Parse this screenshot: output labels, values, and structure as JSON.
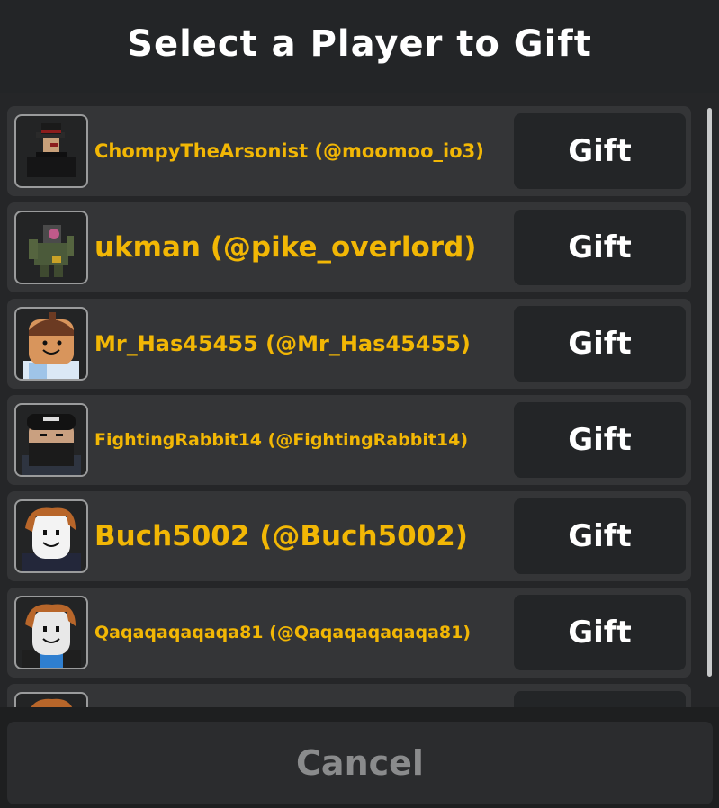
{
  "dialog": {
    "title": "Select a Player to Gift",
    "cancel_label": "Cancel"
  },
  "players": [
    {
      "name": "ChompyTheArsonist (@moomoo_io3)",
      "button": "Gift",
      "avatar": "avatar-fedora-icon"
    },
    {
      "name": "ukman (@pike_overlord)",
      "button": "Gift",
      "avatar": "avatar-camo-icon"
    },
    {
      "name": "Mr_Has45455 (@Mr_Has45455)",
      "button": "Gift",
      "avatar": "avatar-smile-icon"
    },
    {
      "name": "FightingRabbit14 (@FightingRabbit14)",
      "button": "Gift",
      "avatar": "avatar-masked-icon"
    },
    {
      "name": "Buch5002 (@Buch5002)",
      "button": "Gift",
      "avatar": "avatar-noob-icon"
    },
    {
      "name": "Qaqaqaqaqaqa81 (@Qaqaqaqaqaqa81)",
      "button": "Gift",
      "avatar": "avatar-noob-blue-icon"
    },
    {
      "name": "",
      "button": "",
      "avatar": "avatar-partial-icon"
    }
  ],
  "colors": {
    "name_text": "#f2b705",
    "row_bg": "#343537",
    "button_bg": "#232527"
  }
}
